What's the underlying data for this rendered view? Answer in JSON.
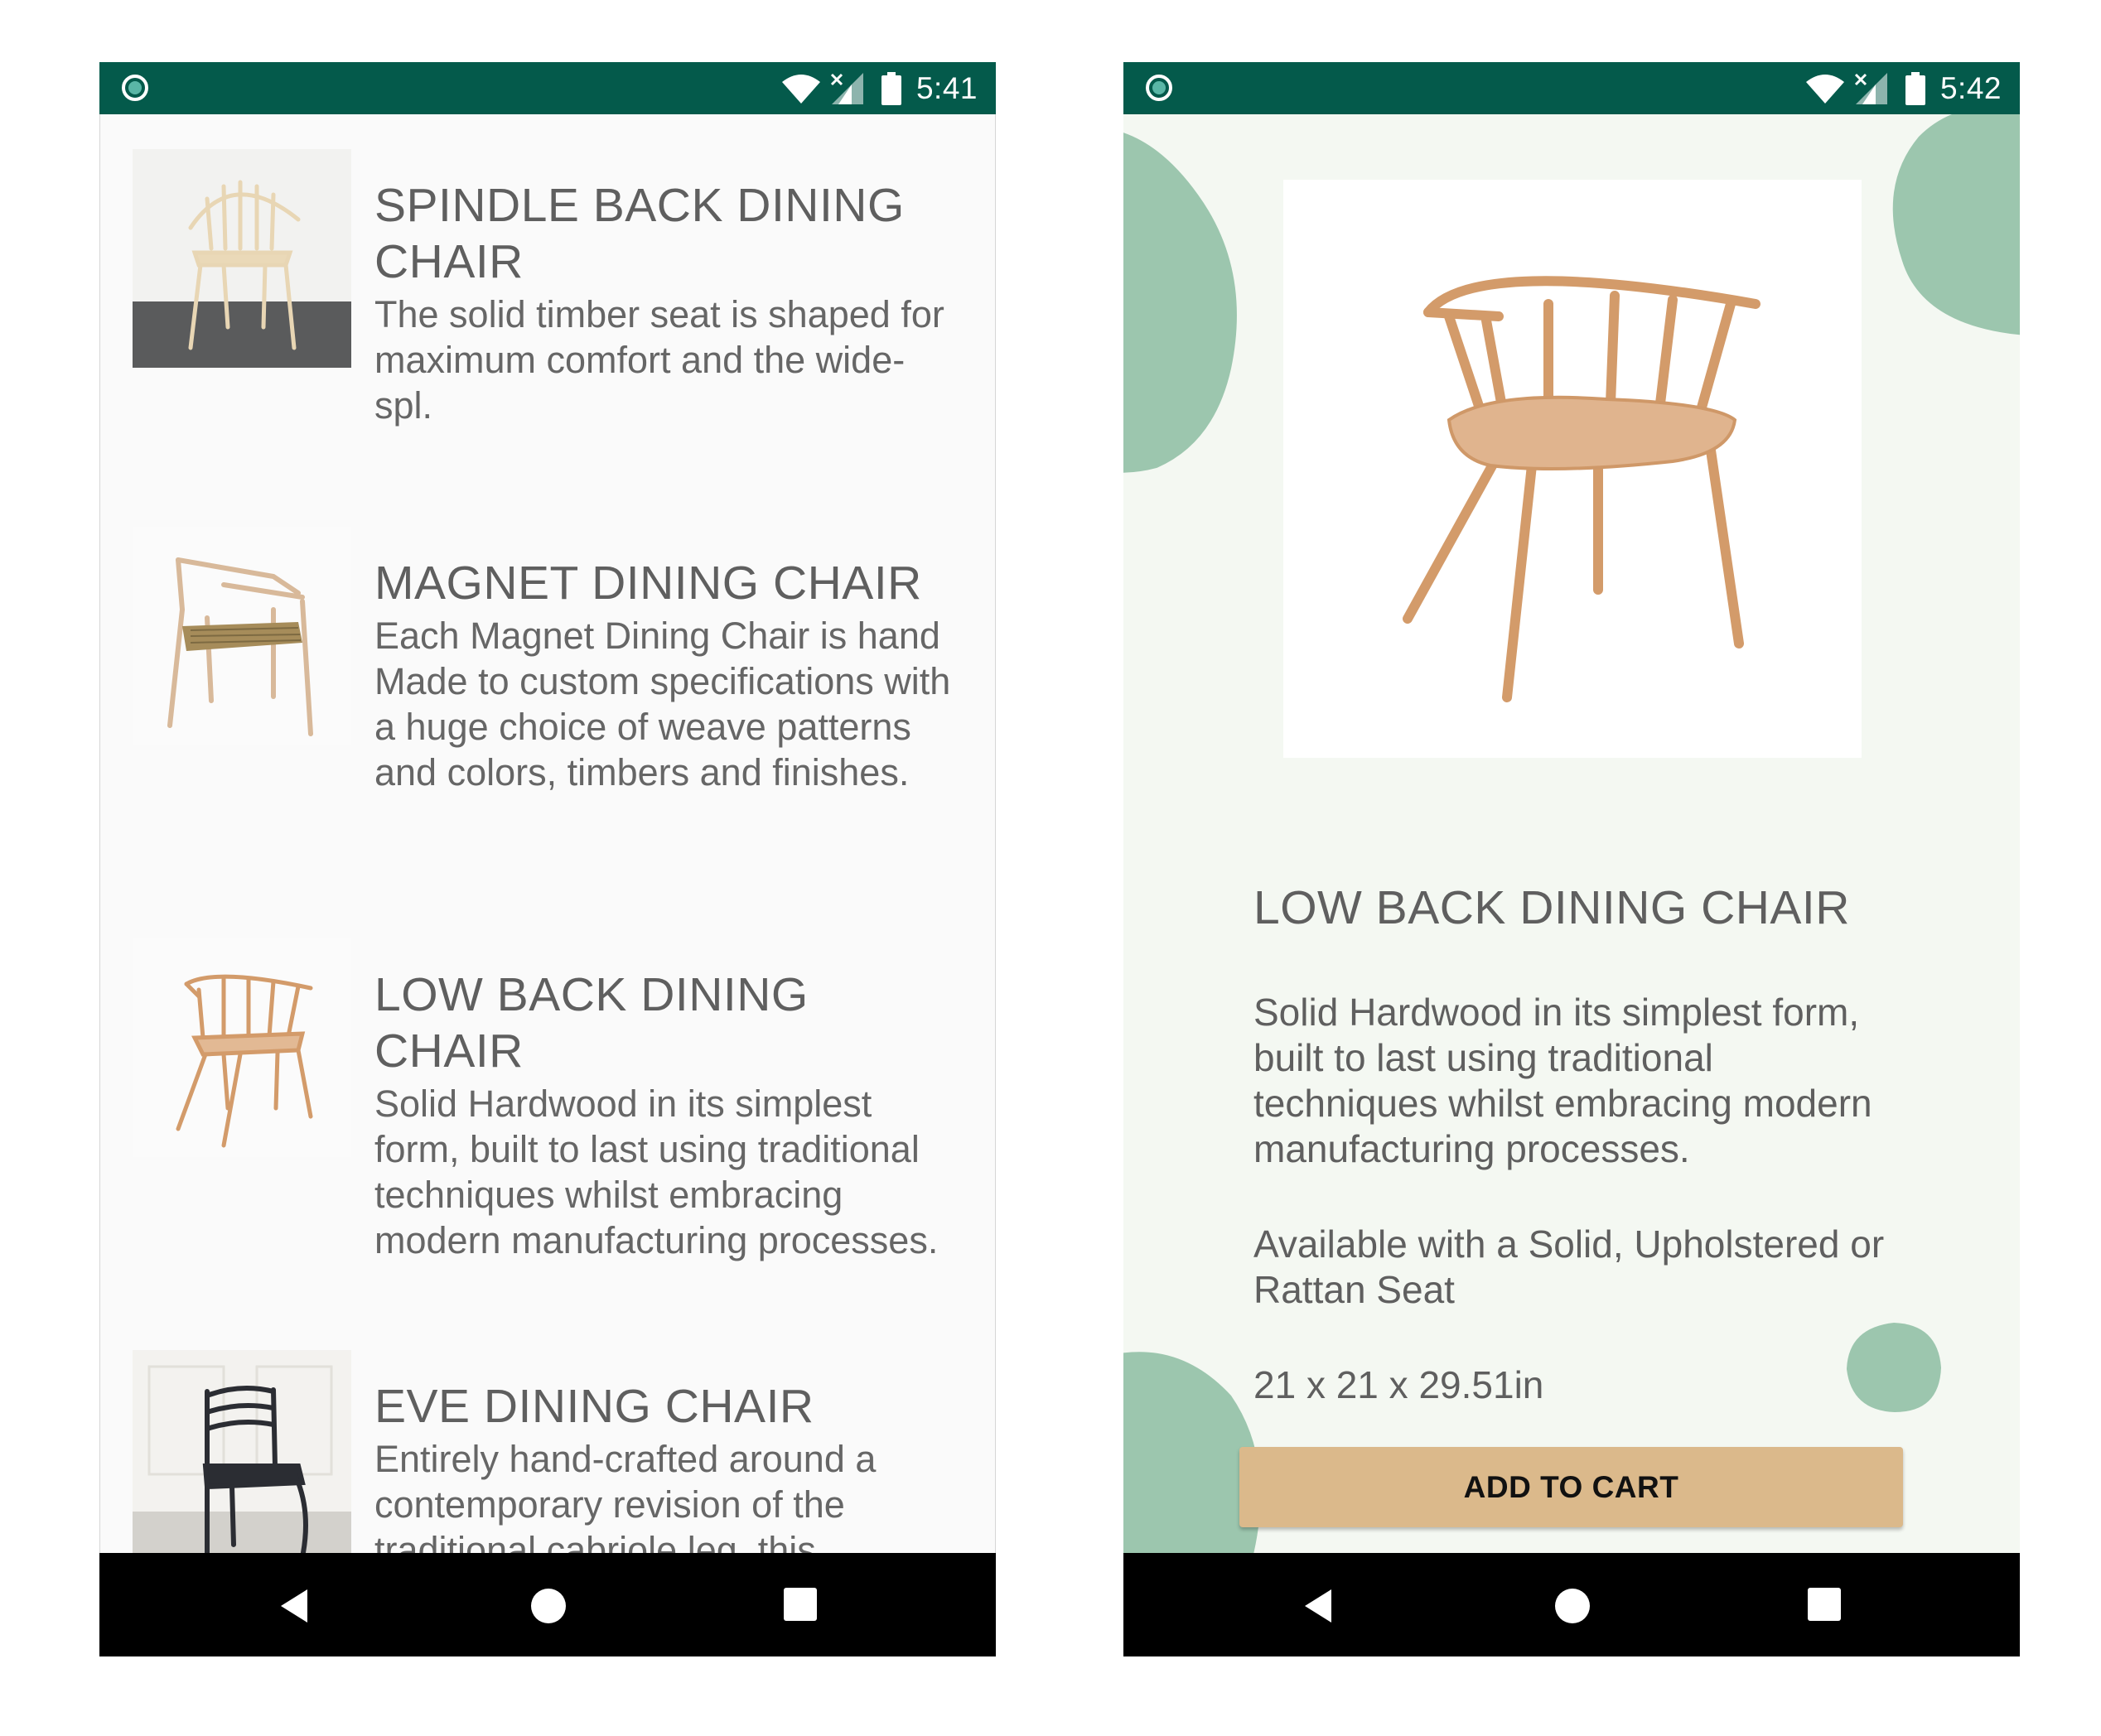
{
  "left_screen": {
    "status": {
      "time": "5:41"
    },
    "products": [
      {
        "title": "SPINDLE BACK DINING CHAIR",
        "description": "The solid timber seat is shaped for maximum comfort and the wide-spl."
      },
      {
        "title": "MAGNET DINING CHAIR",
        "description": "Each Magnet Dining Chair is hand Made to custom specifications with a huge choice of weave patterns and colors, timbers and finishes."
      },
      {
        "title": "LOW BACK DINING CHAIR",
        "description": "Solid Hardwood in its simplest form, built to last using traditional techniques whilst embracing modern manufacturing processes."
      },
      {
        "title": "EVE DINING CHAIR",
        "description": "Entirely hand-crafted around a contemporary revision of the traditional cabriole leg, this"
      }
    ]
  },
  "right_screen": {
    "status": {
      "time": "5:42"
    },
    "product": {
      "title": "LOW BACK DINING CHAIR",
      "description": "Solid Hardwood in its simplest form, built to last using traditional techniques whilst embracing modern manufacturing processes.",
      "availability": "Available with a Solid, Upholstered or Rattan Seat",
      "dimensions": "21 x 21 x 29.51in",
      "cta_label": "ADD TO CART"
    }
  },
  "icons": {
    "status_left": "notification-dot-icon",
    "status_right": [
      "wifi-icon",
      "signal-icon",
      "battery-icon"
    ],
    "nav": [
      "back-icon",
      "home-icon",
      "recents-icon"
    ]
  },
  "colors": {
    "status_bar": "#045a4b",
    "accent_blob": "#9cc6ae",
    "cta_button": "#dbb98b",
    "detail_background": "#f4f8f2",
    "nav_bar": "#000000"
  }
}
